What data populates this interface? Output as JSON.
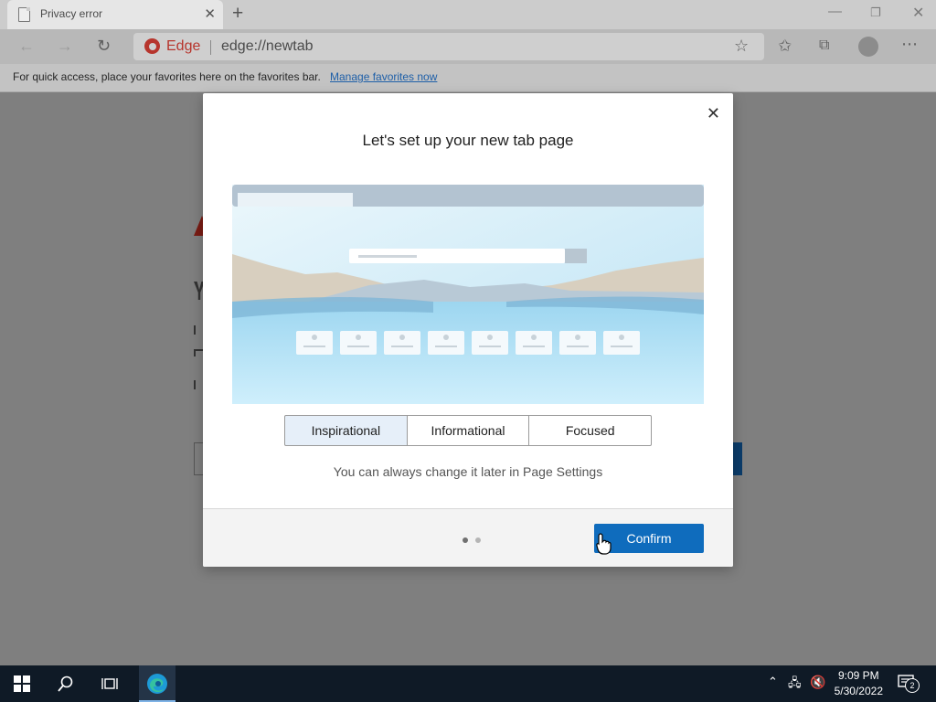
{
  "tab": {
    "title": "Privacy error",
    "close_glyph": "✕",
    "new_tab_glyph": "+"
  },
  "address_bar": {
    "brand": "Edge",
    "url": "edge://newtab"
  },
  "favorites_bar": {
    "message": "For quick access, place your favorites here on the favorites bar.",
    "link": "Manage favorites now"
  },
  "dialog": {
    "title": "Let's set up your new tab page",
    "options": [
      "Inspirational",
      "Informational",
      "Focused"
    ],
    "selected_option": "Inspirational",
    "hint": "You can always change it later in Page Settings",
    "confirm_label": "Confirm",
    "page_indicator": {
      "total": 2,
      "current": 1
    }
  },
  "taskbar": {
    "time": "9:09 PM",
    "date": "5/30/2022",
    "notification_count": "2"
  },
  "colors": {
    "accent": "#0f6cbd",
    "edge_brand": "#b7352d",
    "selected_option_bg": "#e6eff9"
  }
}
